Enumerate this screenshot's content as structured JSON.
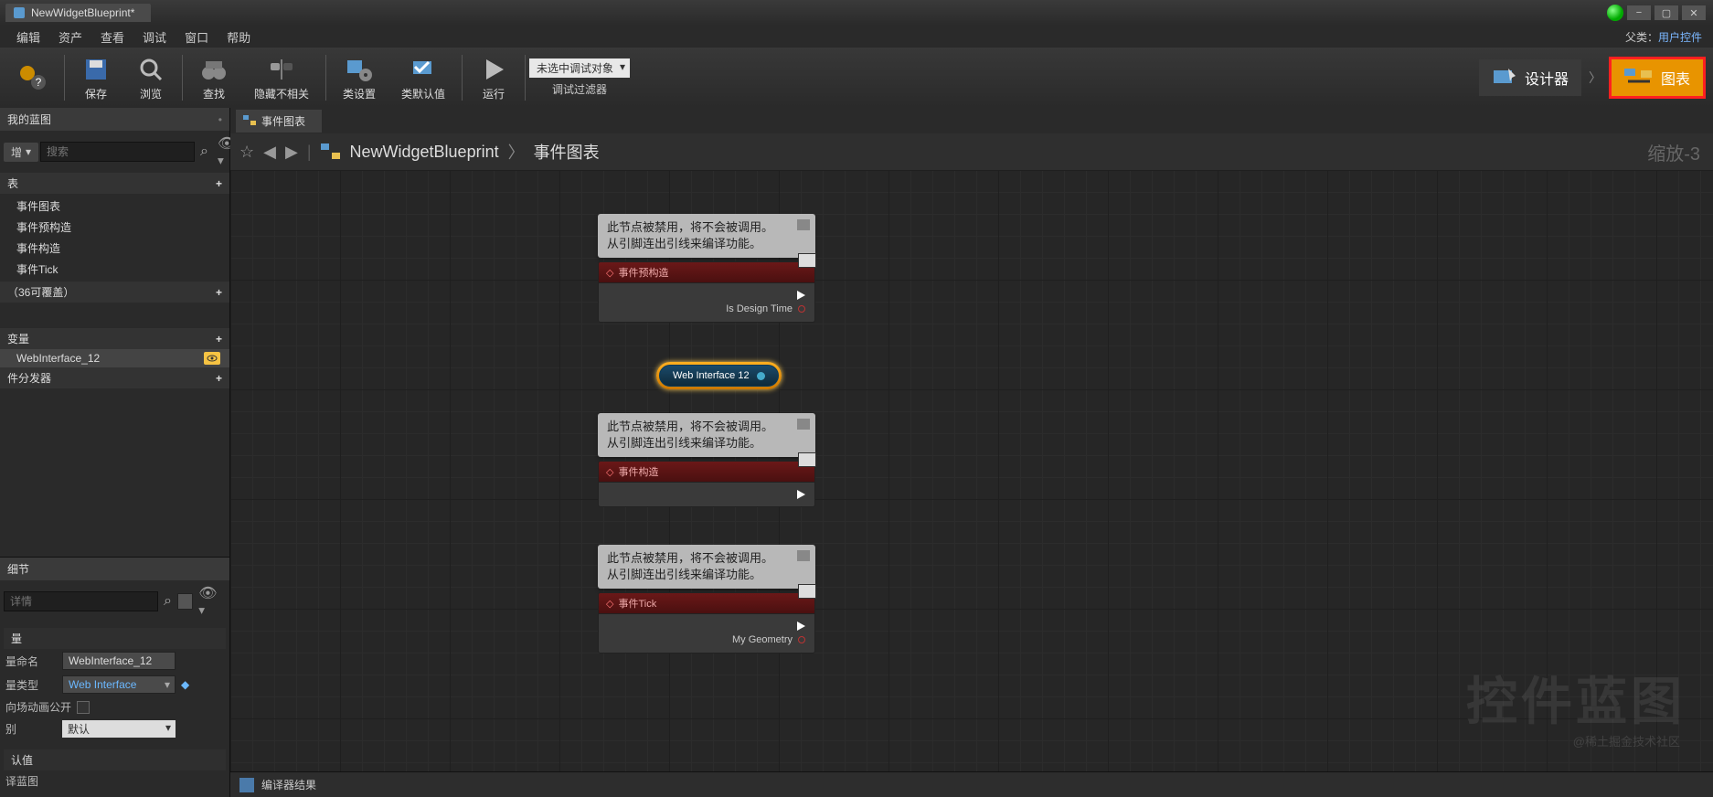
{
  "titlebar": {
    "title": "NewWidgetBlueprint*"
  },
  "menu": {
    "items": [
      "编辑",
      "资产",
      "查看",
      "调试",
      "窗口",
      "帮助"
    ],
    "parent_label": "父类：",
    "parent_value": "用户控件"
  },
  "toolbar": {
    "save": "保存",
    "browse": "浏览",
    "find": "查找",
    "hide": "隐藏不相关",
    "settings": "类设置",
    "defaults": "类默认值",
    "play": "运行",
    "debug_select": "未选中调试对象",
    "debug_label": "调试过滤器",
    "designer": "设计器",
    "graph": "图表"
  },
  "left": {
    "mybp": "我的蓝图",
    "add": "增",
    "search": "搜索",
    "section_graph": "表",
    "section_fn": "（36可覆盖）",
    "section_var": "变量",
    "section_disp": "件分发器",
    "items": [
      "事件图表",
      "事件预构造",
      "事件构造",
      "事件Tick"
    ],
    "var_item": "WebInterface_12",
    "details": "细节",
    "details_search": "详情",
    "variable_cat": "量",
    "name_lbl": "量命名",
    "name_val": "WebInterface_12",
    "type_lbl": "量类型",
    "type_val": "Web Interface",
    "anim_lbl": "向场动画公开",
    "mode_lbl": "别",
    "mode_val": "默认",
    "default_lbl": "认值",
    "footer": "译蓝图"
  },
  "graph": {
    "tab": "事件图表",
    "bc_root": "NewWidgetBlueprint",
    "bc_leaf": "事件图表",
    "zoom": "缩放-3",
    "tooltip_l1": "此节点被禁用，将不会被调用。",
    "tooltip_l2": "从引脚连出引线来编译功能。",
    "node1_title": "事件预构造",
    "node1_pin": "Is Design Time",
    "node_web": "Web Interface 12",
    "node2_title": "事件构造",
    "node3_title": "事件Tick",
    "node3_pin": "My Geometry",
    "compiler": "编译器结果"
  },
  "watermark": {
    "big": "控件蓝图",
    "small": "@稀土掘金技术社区"
  }
}
